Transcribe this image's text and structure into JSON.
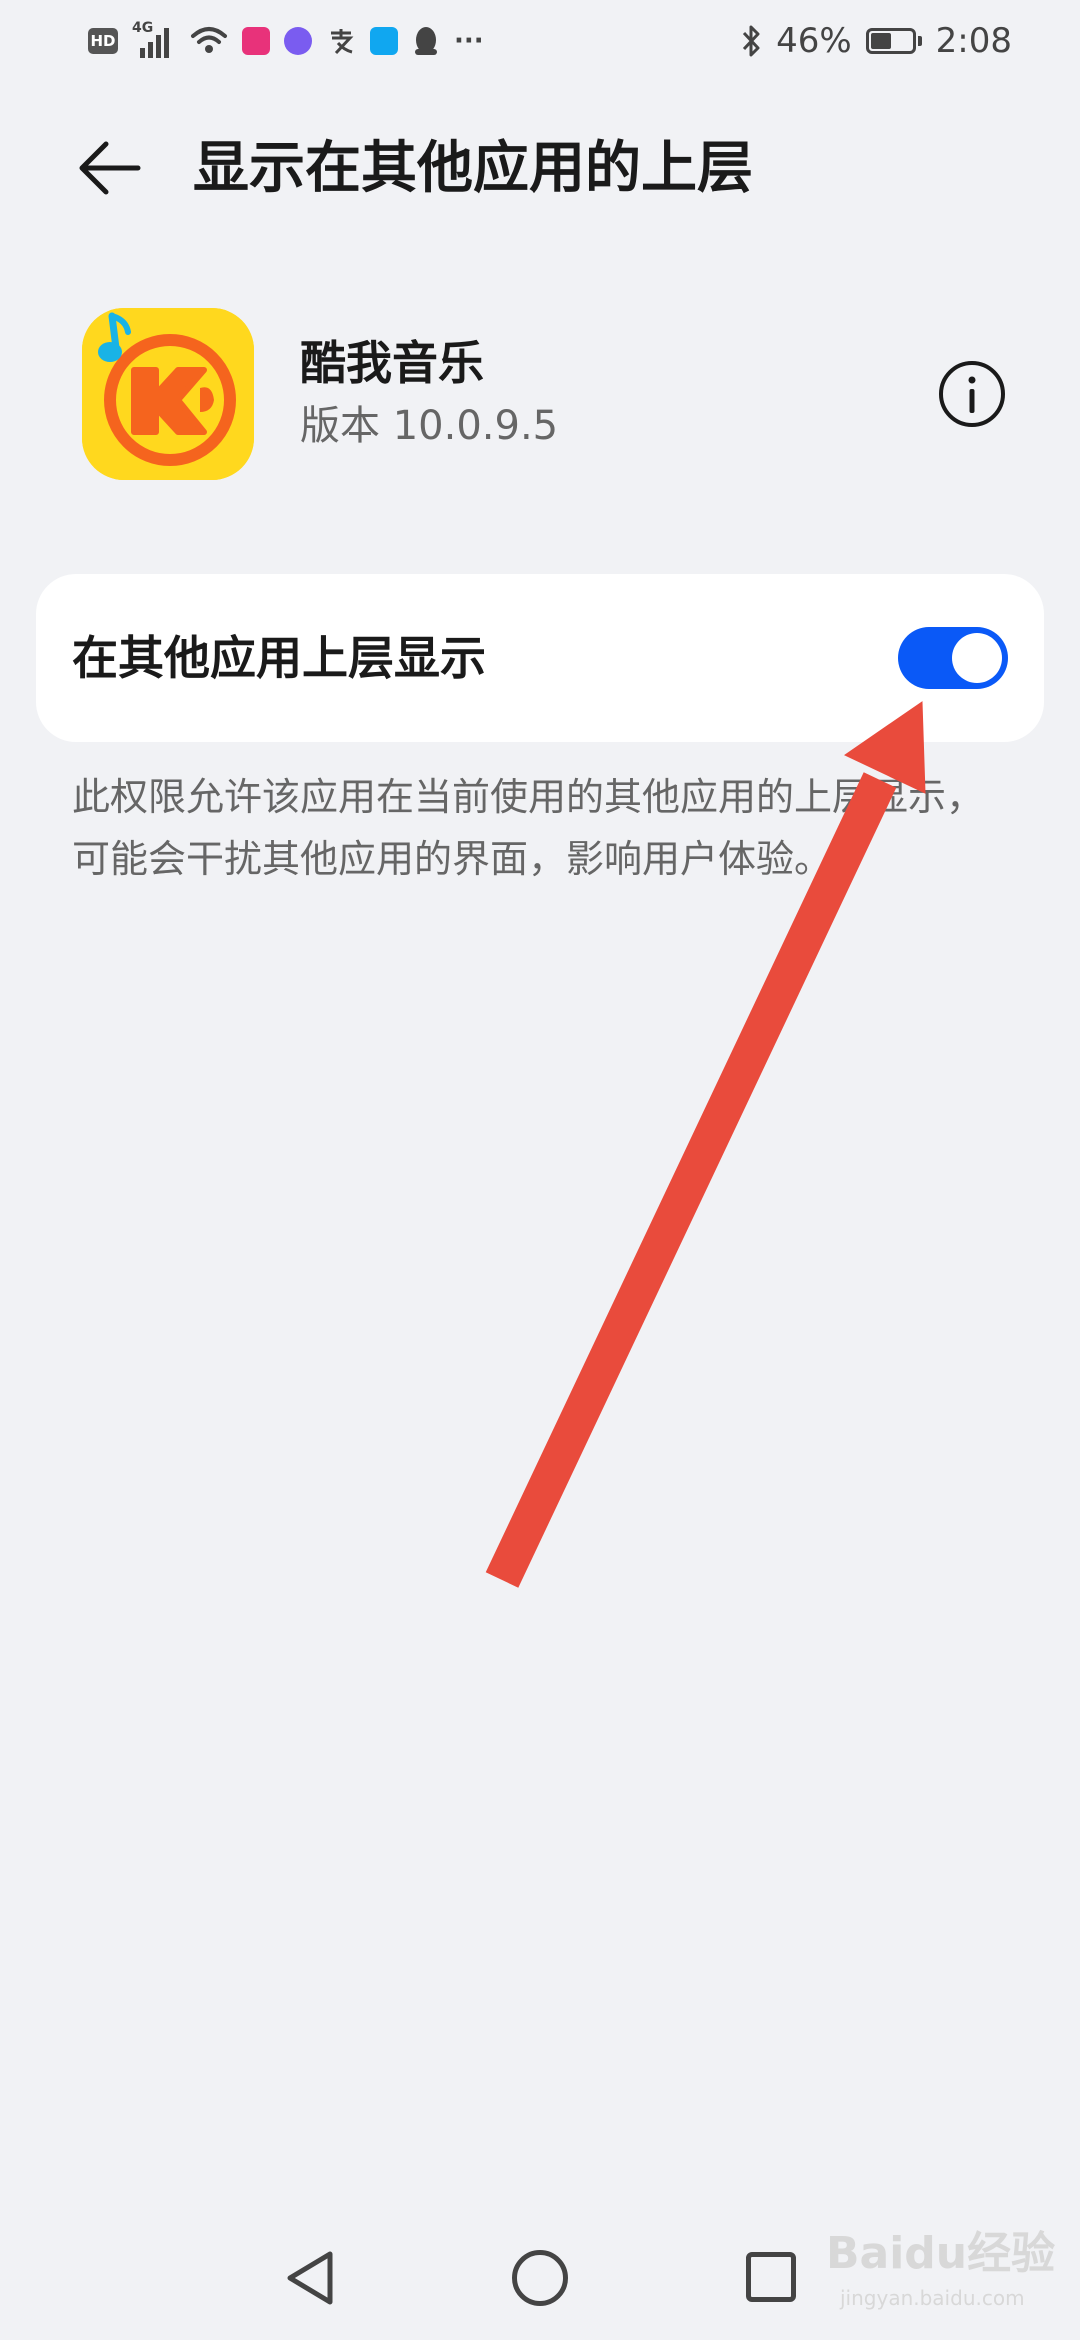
{
  "status_bar": {
    "hd_label": "HD",
    "network": "4G",
    "battery_percent": "46%",
    "battery_level": 0.46,
    "time": "2:08",
    "more_label": "···"
  },
  "header": {
    "title": "显示在其他应用的上层"
  },
  "app": {
    "name": "酷我音乐",
    "version": "版本 10.0.9.5",
    "icon_name": "kuwo-music-icon"
  },
  "setting": {
    "label": "在其他应用上层显示",
    "enabled": true,
    "toggle_color": "#0a59f7"
  },
  "description": "此权限允许该应用在当前使用的其他应用的上层显示，可能会干扰其他应用的界面，影响用户体验。",
  "annotation": {
    "arrow_color": "#e94b3c"
  },
  "watermark": {
    "text": "Baidu经验",
    "sub": "jingyan.baidu.com"
  }
}
